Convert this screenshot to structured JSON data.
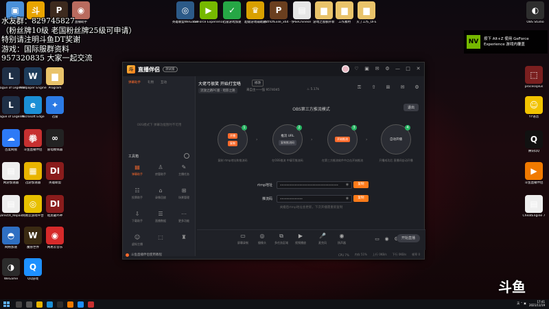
{
  "desktop": {
    "stream_notice": [
      "水友群：829745827",
      "（粉丝牌10级 老国粉丝牌25级可申请）",
      "特别请注明斗鱼DT奖谢",
      "游戏：国际服群资料",
      "957320835 大家一起交流"
    ],
    "icons_top": [
      {
        "label": "此电脑",
        "color": "#4a90d9",
        "glyph": "▣"
      },
      {
        "label": "斗鱼",
        "color": "#e8a400",
        "glyph": "斗"
      },
      {
        "label": "PUBG",
        "color": "#3d2a1e",
        "glyph": "P"
      },
      {
        "label": "直播助手",
        "color": "#b96b5e",
        "glyph": "◉"
      },
      {
        "label": "英雄联盟WeGame",
        "color": "#2c5a88",
        "glyph": "◎"
      },
      {
        "label": "GeForce Experience",
        "color": "#76b900",
        "glyph": "▶"
      },
      {
        "label": "迅雷游戏加速",
        "color": "#26a745",
        "glyph": "✓"
      },
      {
        "label": "超级游戏辅助器",
        "color": "#d9a000",
        "glyph": "♛"
      },
      {
        "label": "PathOfExile_x64 - 快捷方式",
        "color": "#6b3f1f",
        "glyph": "P"
      },
      {
        "label": "PoeChinese",
        "color": "#e6e6e6",
        "glyph": "▤"
      },
      {
        "label": "游戏之窗额外新",
        "color": "#e9c36a",
        "glyph": "▆"
      },
      {
        "label": "工作素材",
        "color": "#e9c36a",
        "glyph": "▆"
      },
      {
        "label": "火了工作_OFE",
        "color": "#e9c36a",
        "glyph": "▆"
      },
      {
        "label": "OBS Studio",
        "color": "#2e2e2e",
        "glyph": "◐"
      }
    ],
    "icons_left": [
      {
        "label": "League of Legends",
        "color": "#1f2f46",
        "glyph": "L"
      },
      {
        "label": "Wallpaper Engine",
        "color": "#1d3b5a",
        "glyph": "W"
      },
      {
        "label": "Program",
        "color": "#e9c36a",
        "glyph": "▆"
      },
      {
        "label": "League of Legends PBE",
        "color": "#1f2f46",
        "glyph": "L"
      },
      {
        "label": "Microsoft Edge",
        "color": "#1b8fd6",
        "glyph": "e"
      },
      {
        "label": "迅雷",
        "color": "#2c7be5",
        "glyph": "✦"
      },
      {
        "label": "百度网盘",
        "color": "#2d7af6",
        "glyph": "☁"
      },
      {
        "label": "斗鱼直播伴侣",
        "color": "#c73030",
        "glyph": "拳"
      },
      {
        "label": "雷电模拟器",
        "color": "#222",
        "glyph": "∞"
      },
      {
        "label": "网游加速器",
        "color": "#eeeeee",
        "glyph": "▤"
      },
      {
        "label": "迅游加速器",
        "color": "#e8b400",
        "glyph": "▦"
      },
      {
        "label": "英雄联盟",
        "color": "#8a1c1c",
        "glyph": "DI"
      },
      {
        "label": "DirectX_Repair",
        "color": "#eeeeee",
        "glyph": "▤"
      },
      {
        "label": "网易云游戏平台",
        "color": "#e8c000",
        "glyph": "◎"
      },
      {
        "label": "暗黑破坏神",
        "color": "#8a1c1c",
        "glyph": "DI"
      },
      {
        "label": "网络加速",
        "color": "#2f6fc2",
        "glyph": "◓"
      },
      {
        "label": "魔兽世界",
        "color": "#3a2a12",
        "glyph": "W"
      },
      {
        "label": "网易云音乐",
        "color": "#d62a2a",
        "glyph": "◉"
      },
      {
        "label": "WeGame",
        "color": "#2b2b2b",
        "glyph": "◑"
      },
      {
        "label": "QQ游戏",
        "color": "#1e90ff",
        "glyph": "Q"
      }
    ],
    "icons_right": [
      {
        "label": "processplus",
        "color": "#7a1f1f",
        "glyph": "⬚"
      },
      {
        "label": "YY语音",
        "color": "#f2c300",
        "glyph": "☺"
      },
      {
        "label": "腾讯QQ",
        "color": "#111",
        "glyph": "Q"
      },
      {
        "label": "斗鱼直播伴侣",
        "color": "#f07a00",
        "glyph": "▶"
      },
      {
        "label": "CheatEngine 7",
        "color": "#eeeeee",
        "glyph": "▤"
      }
    ],
    "gf_toast": {
      "badge": "NV",
      "line1": "按下 Alt+Z 使用 GeForce",
      "line2": "Experience 游戏内覆盖"
    },
    "watermark": "斗鱼"
  },
  "app": {
    "logo_glyph": "斗",
    "name": "直播伴侣",
    "version": "测试版",
    "titlebar_icons": [
      "♡",
      "▣",
      "✉",
      "⚙",
      "—",
      "□",
      "✕"
    ],
    "left_tabs": [
      "弹幕助手",
      "礼物",
      "互动"
    ],
    "left_empty": "OBS模式下 弹幕功能暂时不可用",
    "tools_title": "工具箱",
    "tools": [
      {
        "label": "弹幕助手",
        "glyph": "▤",
        "hot": true
      },
      {
        "label": "房管助手",
        "glyph": "♙",
        "hot": false
      },
      {
        "label": "主播任务",
        "glyph": "✎",
        "hot": false
      },
      {
        "label": "投票助手",
        "glyph": "☷",
        "hot": false
      },
      {
        "label": "录像回放",
        "glyph": "⌂",
        "hot": false
      },
      {
        "label": "场景管理",
        "glyph": "⊞",
        "hot": false
      },
      {
        "label": "下载助手",
        "glyph": "⇩",
        "hot": false
      },
      {
        "label": "直播数据",
        "glyph": "☰",
        "hot": false
      },
      {
        "label": "更多功能",
        "glyph": "⋯",
        "hot": false
      },
      {
        "label": "虚拟主播",
        "glyph": "☺",
        "hot": false
      },
      {
        "label": "",
        "glyph": "⬚",
        "hot": false
      },
      {
        "label": "",
        "glyph": "♜",
        "hot": false
      }
    ],
    "footer": "斗鱼直播伴侣使用教程",
    "room": {
      "title": "大佬弓很笑 开始打宝咯",
      "edit": "修改",
      "category": "流放之路PC版 · 暗影之路",
      "info": "来自主一一强",
      "room_id": "9574045",
      "hot": "5.17k"
    },
    "room_icons": [
      "⚿",
      "⇧",
      "⊞",
      "✉",
      "⚙"
    ],
    "obs": {
      "mode_title": "OBS第三方推流模式",
      "exit": "退出",
      "steps": [
        {
          "num": "1",
          "pills": [
            {
              "text": "开播",
              "style": "orange"
            },
            {
              "text": "复制",
              "style": "orange"
            }
          ],
          "plain": "",
          "desc": "复制 rtmp地址和推流码"
        },
        {
          "num": "2",
          "pills": [],
          "plain": "推流 URL",
          "plain2": "复制推流码",
          "desc": "在OBS推流 中填写推流码"
        },
        {
          "num": "3",
          "pills": [
            {
              "text": "开始推流",
              "style": "orange"
            }
          ],
          "plain": "",
          "desc": "在第三方推流软件中点击开始推流"
        },
        {
          "num": "4",
          "pills": [],
          "plain": "自动开播",
          "plain2": "",
          "desc": "开播成功后 直播间自动开播"
        }
      ],
      "arrows": [
        "›",
        "›",
        "›"
      ],
      "rtmp_label": "rtmp地址",
      "rtmp_value": "••••••••••••••••••••••••••••••••••••",
      "key_label": "推流码",
      "key_value": "••••••••••••••",
      "copy_label": "复制",
      "hint": "关播后rtmp地址会更新，下次开播需重新复制"
    },
    "bottom_tools": [
      {
        "label": "屏幕录制",
        "glyph": "▭"
      },
      {
        "label": "摄像头",
        "glyph": "◎"
      },
      {
        "label": "多任务区域",
        "glyph": "⧉"
      },
      {
        "label": "视频播放",
        "glyph": "▶"
      },
      {
        "label": "麦克风",
        "glyph": "🎤"
      },
      {
        "label": "扬声器",
        "glyph": "◉"
      }
    ],
    "go_live": "开始直播",
    "status": [
      "CPU 7%",
      "内存 51%",
      "上行 0KB/s",
      "下行 0KB/s",
      "帧率 0"
    ]
  },
  "taskbar": {
    "clock_time": "17:41",
    "clock_date": "2021/11/19",
    "tray_text": "英 ⌃ ▣"
  }
}
